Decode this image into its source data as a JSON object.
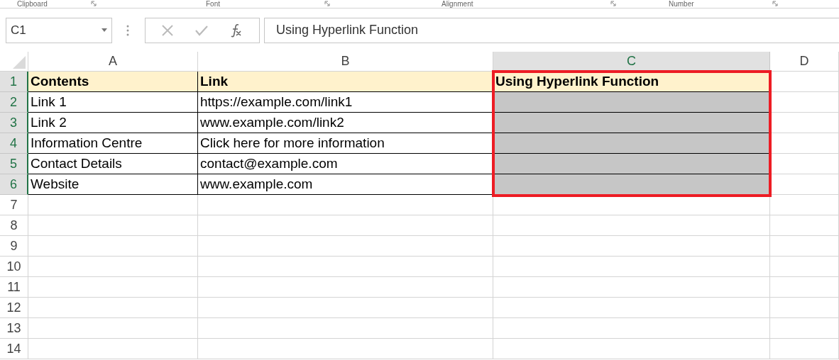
{
  "ribbon_groups": [
    {
      "label": "Clipboard"
    },
    {
      "label": "Font"
    },
    {
      "label": "Alignment"
    },
    {
      "label": "Number"
    }
  ],
  "name_box": "C1",
  "formula": "Using Hyperlink Function",
  "columns": [
    {
      "label": "A",
      "selected": false
    },
    {
      "label": "B",
      "selected": false
    },
    {
      "label": "C",
      "selected": true
    },
    {
      "label": "D",
      "selected": false
    }
  ],
  "rows": [
    {
      "number": "1",
      "selected": true,
      "kind": "header",
      "cells": [
        "Contents",
        "Link",
        "Using Hyperlink Function"
      ]
    },
    {
      "number": "2",
      "selected": true,
      "kind": "data",
      "cells": [
        "Link 1",
        "https://example.com/link1"
      ]
    },
    {
      "number": "3",
      "selected": true,
      "kind": "data",
      "cells": [
        "Link 2",
        "www.example.com/link2"
      ]
    },
    {
      "number": "4",
      "selected": true,
      "kind": "data",
      "cells": [
        "Information Centre",
        "Click here for more information"
      ]
    },
    {
      "number": "5",
      "selected": true,
      "kind": "data",
      "cells": [
        "Contact Details",
        "contact@example.com"
      ]
    },
    {
      "number": "6",
      "selected": true,
      "kind": "data",
      "cells": [
        "Website",
        "www.example.com"
      ]
    },
    {
      "number": "7",
      "selected": false,
      "kind": "empty"
    },
    {
      "number": "8",
      "selected": false,
      "kind": "empty"
    },
    {
      "number": "9",
      "selected": false,
      "kind": "empty"
    },
    {
      "number": "10",
      "selected": false,
      "kind": "empty"
    },
    {
      "number": "11",
      "selected": false,
      "kind": "empty"
    },
    {
      "number": "12",
      "selected": false,
      "kind": "empty"
    },
    {
      "number": "13",
      "selected": false,
      "kind": "empty"
    },
    {
      "number": "14",
      "selected": false,
      "kind": "empty"
    }
  ]
}
